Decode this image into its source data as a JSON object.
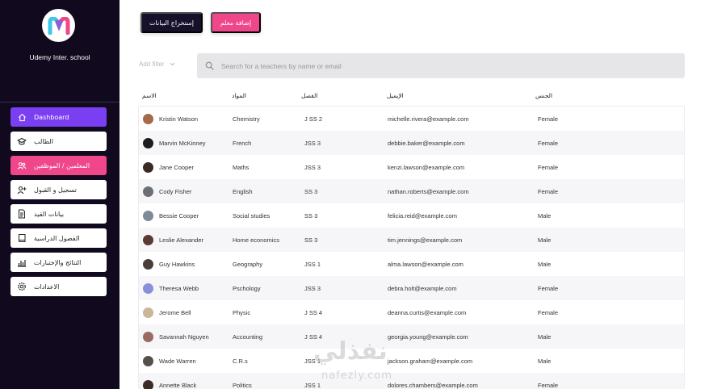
{
  "sidebar": {
    "school_name": "Udemy Inter. school",
    "items": [
      {
        "label": "Dashboard",
        "icon": "home-icon",
        "state": "active-dash"
      },
      {
        "label": "الطالب",
        "icon": "graduation-cap-icon",
        "state": ""
      },
      {
        "label": "المعلمين / الموظفين",
        "icon": "users-icon",
        "state": "active-pink"
      },
      {
        "label": "تسجيل و القبول",
        "icon": "add-user-icon",
        "state": ""
      },
      {
        "label": "بيانات القيد",
        "icon": "document-icon",
        "state": ""
      },
      {
        "label": "الفصول الدراسية",
        "icon": "book-icon",
        "state": ""
      },
      {
        "label": "النتائج والإختبارات",
        "icon": "chart-icon",
        "state": ""
      },
      {
        "label": "الاعدادات",
        "icon": "gear-icon",
        "state": ""
      }
    ]
  },
  "toolbar": {
    "extract_label": "إستخراج البيانات",
    "add_teacher_label": "إضافة معلم"
  },
  "filter": {
    "label": "Add filter"
  },
  "search": {
    "placeholder": "Search for a teachers by name or email"
  },
  "table": {
    "headers": {
      "name": "الاسم",
      "subject": "المواد",
      "class": "الفصل",
      "email": "الإيميل",
      "gender": "الجنس"
    },
    "rows": [
      {
        "name": "Kristin Watson",
        "subject": "Chemistry",
        "class": "J SS 2",
        "email": "michelle.rivera@example.com",
        "gender": "Female",
        "avatar_color": "#a56a4a"
      },
      {
        "name": "Marvin McKinney",
        "subject": "French",
        "class": "JSS 3",
        "email": "debbie.baker@example.com",
        "gender": "Female",
        "avatar_color": "#1c1c1c"
      },
      {
        "name": "Jane Cooper",
        "subject": "Maths",
        "class": "JSS 3",
        "email": "kenzi.lawson@example.com",
        "gender": "Female",
        "avatar_color": "#3b2a24"
      },
      {
        "name": "Cody Fisher",
        "subject": "English",
        "class": "SS 3",
        "email": "nathan.roberts@example.com",
        "gender": "Female",
        "avatar_color": "#6b6f76"
      },
      {
        "name": "Bessie Cooper",
        "subject": "Social studies",
        "class": "SS 3",
        "email": "felicia.reid@example.com",
        "gender": "Male",
        "avatar_color": "#7e8a96"
      },
      {
        "name": "Leslie Alexander",
        "subject": "Home economics",
        "class": "SS 3",
        "email": "tim.jennings@example.com",
        "gender": "Male",
        "avatar_color": "#5a3a34"
      },
      {
        "name": "Guy Hawkins",
        "subject": "Geography",
        "class": "JSS 1",
        "email": "alma.lawson@example.com",
        "gender": "Male",
        "avatar_color": "#4a3e3a"
      },
      {
        "name": "Theresa Webb",
        "subject": "Pschology",
        "class": "JSS 3",
        "email": "debra.holt@example.com",
        "gender": "Female",
        "avatar_color": "#8a90d8"
      },
      {
        "name": "Jerome Bell",
        "subject": "Physic",
        "class": "J SS 4",
        "email": "deanna.curtis@example.com",
        "gender": "Female",
        "avatar_color": "#c9b79a"
      },
      {
        "name": "Savannah Nguyen",
        "subject": "Accounting",
        "class": "J SS 4",
        "email": "georgia.young@example.com",
        "gender": "Male",
        "avatar_color": "#9a6b62"
      },
      {
        "name": "Wade Warren",
        "subject": "C.R.s",
        "class": "JSS 1",
        "email": "jackson.graham@example.com",
        "gender": "Male",
        "avatar_color": "#55504a"
      },
      {
        "name": "Annette Black",
        "subject": "Politics",
        "class": "JSS 1",
        "email": "dolores.chambers@example.com",
        "gender": "Female",
        "avatar_color": "#3a2c28"
      }
    ]
  },
  "watermark": {
    "arabic": "نفذلي",
    "latin": "nafezly.com"
  },
  "colors": {
    "sidebar_bg": "#110a1e",
    "accent_purple": "#7b3ff2",
    "accent_pink": "#f0468a",
    "dark_button": "#17102a",
    "logo_cyan": "#3fc6e8",
    "logo_pink": "#f0468a"
  }
}
